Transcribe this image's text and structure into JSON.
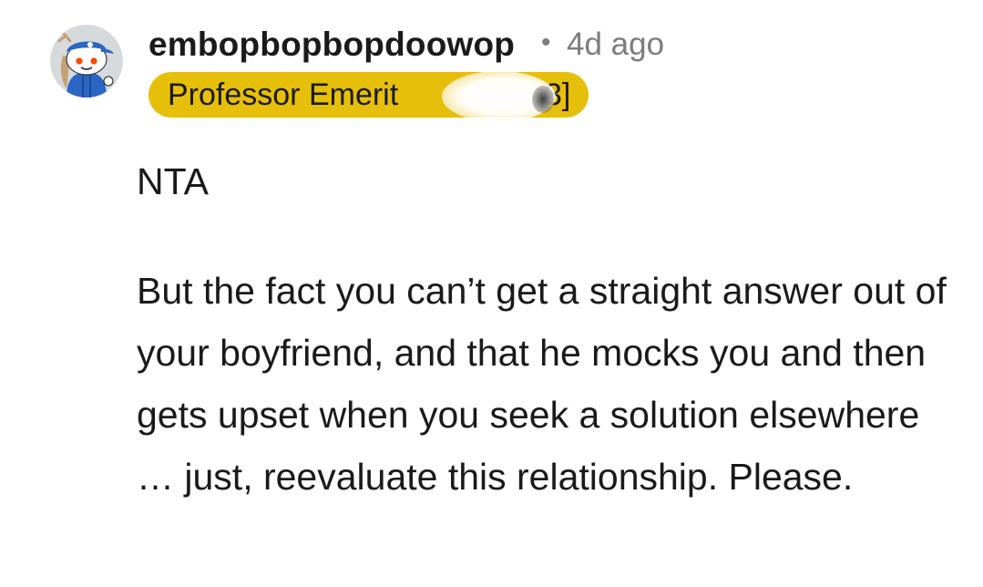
{
  "comment": {
    "username": "embopbopbopdoowop",
    "separator": "•",
    "timestamp": "4d ago",
    "flair": {
      "text": "Professor Emerit",
      "trailing_text": "3]",
      "color": "#e6bf0b"
    },
    "avatar_icon": "reddit-snoo-avatar-icon",
    "body": {
      "paragraph_1": "NTA",
      "paragraph_2": "But the fact you can’t get a straight answer out of your boyfriend, and that he mocks you and then gets upset when you seek a solution elsewhere … just, reevaluate this relationship. Please."
    }
  }
}
